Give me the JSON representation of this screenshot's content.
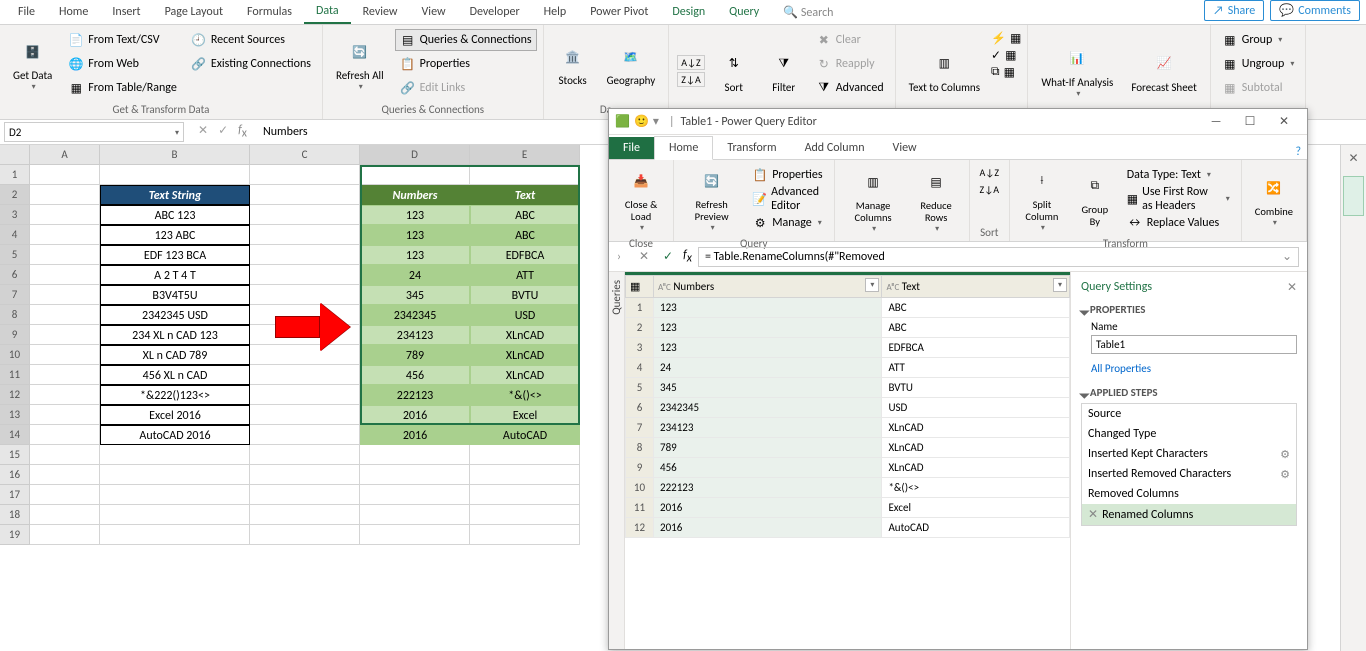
{
  "excel": {
    "tabs": [
      "File",
      "Home",
      "Insert",
      "Page Layout",
      "Formulas",
      "Data",
      "Review",
      "View",
      "Developer",
      "Help",
      "Power Pivot",
      "Design",
      "Query",
      "Search"
    ],
    "active_tab": "Data",
    "share": "Share",
    "comments": "Comments",
    "ribbon": {
      "get_data": "Get\nData",
      "from_text": "From Text/CSV",
      "from_web": "From Web",
      "from_table": "From Table/Range",
      "recent": "Recent Sources",
      "existing": "Existing Connections",
      "grp_get": "Get & Transform Data",
      "refresh": "Refresh\nAll",
      "qc": "Queries & Connections",
      "properties": "Properties",
      "edit_links": "Edit Links",
      "grp_qc": "Queries & Connections",
      "stocks": "Stocks",
      "geo": "Geography",
      "grp_dt": "Da",
      "sort": "Sort",
      "filter": "Filter",
      "clear": "Clear",
      "reapply": "Reapply",
      "advanced": "Advanced",
      "grp_sort": "",
      "t2c": "Text to\nColumns",
      "whatif": "What-If\nAnalysis",
      "forecast": "Forecast\nSheet",
      "group": "Group",
      "ungroup": "Ungroup",
      "subtotal": "Subtotal"
    },
    "namebox": "D2",
    "formula": "Numbers",
    "columns": [
      "A",
      "B",
      "C",
      "D",
      "E"
    ],
    "rows": [
      1,
      2,
      3,
      4,
      5,
      6,
      7,
      8,
      9,
      10,
      11,
      12,
      13,
      14,
      15,
      16,
      17,
      18,
      19
    ],
    "header1": "Text String",
    "headerD": "Numbers",
    "headerE": "Text",
    "tableB": [
      "ABC 123",
      "123 ABC",
      "EDF 123 BCA",
      "A 2 T 4 T",
      "B3V4T5U",
      "2342345 USD",
      "234 XL n CAD 123",
      "XL n CAD 789",
      "456 XL n CAD",
      "*&222()123<>",
      "Excel 2016",
      "AutoCAD 2016"
    ],
    "tableD": [
      "123",
      "123",
      "123",
      "24",
      "345",
      "2342345",
      "234123",
      "789",
      "456",
      "222123",
      "2016",
      "2016"
    ],
    "tableE": [
      "ABC",
      "ABC",
      "EDFBCA",
      "ATT",
      "BVTU",
      "USD",
      "XLnCAD",
      "XLnCAD",
      "XLnCAD",
      "*&()<>",
      "Excel",
      "AutoCAD"
    ]
  },
  "pq": {
    "title": "Table1 - Power Query Editor",
    "tabs": [
      "File",
      "Home",
      "Transform",
      "Add Column",
      "View"
    ],
    "ribbon": {
      "close": "Close &\nLoad",
      "grp_close": "Close",
      "refresh": "Refresh\nPreview",
      "props": "Properties",
      "adv": "Advanced Editor",
      "manage": "Manage",
      "grp_q": "Query",
      "mcols": "Manage\nColumns",
      "rrows": "Reduce\nRows",
      "sort": "Sort",
      "split": "Split\nColumn",
      "group": "Group\nBy",
      "dt": "Data Type: Text",
      "first": "Use First Row as Headers",
      "replace": "Replace Values",
      "grp_t": "Transform",
      "combine": "Combine"
    },
    "formula": "= Table.RenameColumns(#\"Removed",
    "queries": "Queries",
    "cols": [
      "Numbers",
      "Text"
    ],
    "rows": [
      [
        "123",
        "ABC"
      ],
      [
        "123",
        "ABC"
      ],
      [
        "123",
        "EDFBCA"
      ],
      [
        "24",
        "ATT"
      ],
      [
        "345",
        "BVTU"
      ],
      [
        "2342345",
        "USD"
      ],
      [
        "234123",
        "XLnCAD"
      ],
      [
        "789",
        "XLnCAD"
      ],
      [
        "456",
        "XLnCAD"
      ],
      [
        "222123",
        "*&()<>"
      ],
      [
        "2016",
        "Excel"
      ],
      [
        "2016",
        "AutoCAD"
      ]
    ],
    "settings": {
      "title": "Query Settings",
      "props": "PROPERTIES",
      "name_lbl": "Name",
      "name": "Table1",
      "allprops": "All Properties",
      "applied": "APPLIED STEPS",
      "steps": [
        "Source",
        "Changed Type",
        "Inserted Kept Characters",
        "Inserted Removed Characters",
        "Removed Columns",
        "Renamed Columns"
      ],
      "selected_step": 5
    }
  }
}
